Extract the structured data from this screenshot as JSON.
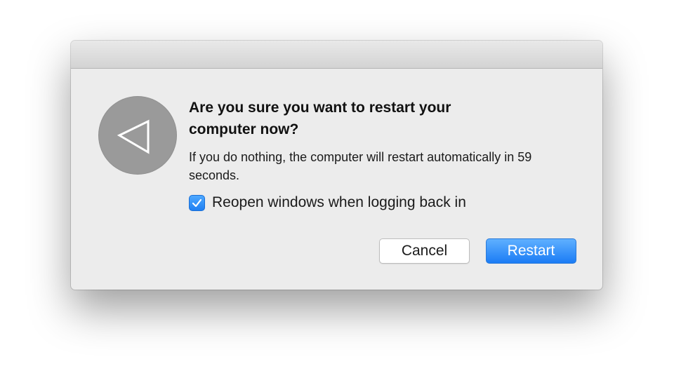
{
  "dialog": {
    "title": "Are you sure you want to restart your computer now?",
    "message": "If you do nothing, the computer will restart automatically in 59 seconds.",
    "icon": "restart-triangle-icon",
    "checkbox": {
      "label": "Reopen windows when logging back in",
      "checked": true
    },
    "buttons": {
      "cancel_label": "Cancel",
      "restart_label": "Restart"
    }
  },
  "colors": {
    "accent": "#1b7cf5",
    "icon_background": "#9a9a9a",
    "dialog_background": "#ececec"
  }
}
